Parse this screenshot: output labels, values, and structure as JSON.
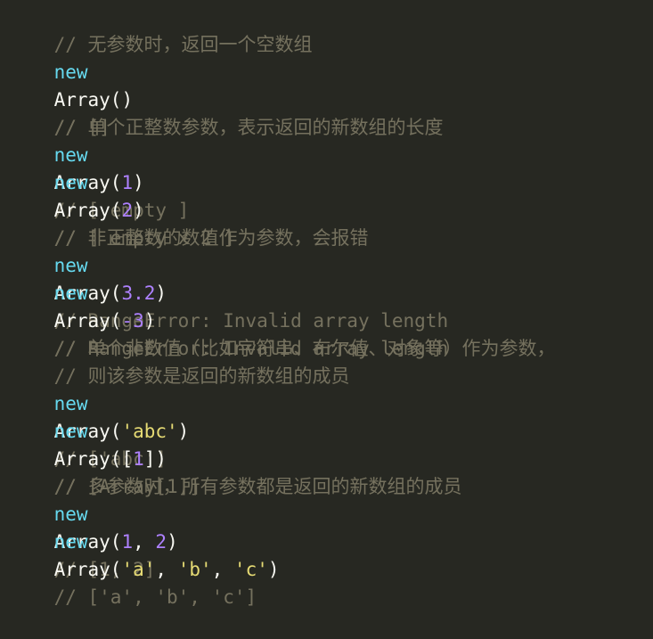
{
  "code": {
    "block1": {
      "comment": "// 无参数时，返回一个空数组",
      "line1": {
        "kw": "new",
        "fn": "Array",
        "open": "(",
        "close": ")",
        "comment": "// []"
      }
    },
    "block2": {
      "comment": "// 单个正整数参数，表示返回的新数组的长度",
      "line1": {
        "kw": "new",
        "fn": "Array",
        "open": "(",
        "arg": "1",
        "close": ")",
        "comment": "// [ empty ]"
      },
      "line2": {
        "kw": "new",
        "fn": "Array",
        "open": "(",
        "arg": "2",
        "close": ")",
        "comment": "// [ empty x 2 ]"
      }
    },
    "block3": {
      "comment": "// 非正整数的数值作为参数，会报错",
      "line1": {
        "kw": "new",
        "fn": "Array",
        "open": "(",
        "arg": "3.2",
        "close": ")",
        "comment": "// RangeError: Invalid array length"
      },
      "line2": {
        "kw": "new",
        "fn": "Array",
        "open": "(",
        "arg": "-3",
        "close": ")",
        "comment": "// RangeError: Invalid array length"
      }
    },
    "block4": {
      "comment1": "// 单个非数值（比如字符串、布尔值、对象等）作为参数，",
      "comment2": "// 则该参数是返回的新数组的成员",
      "line1": {
        "kw": "new",
        "fn": "Array",
        "open": "(",
        "arg": "'abc'",
        "close": ")",
        "comment": "// ['abc']"
      },
      "line2": {
        "kw": "new",
        "fn": "Array",
        "open": "([",
        "arg": "1",
        "close": "])",
        "comment": "// [Array[1]]"
      }
    },
    "block5": {
      "comment": "// 多参数时，所有参数都是返回的新数组的成员",
      "line1": {
        "kw": "new",
        "fn": "Array",
        "open": "(",
        "arg1": "1",
        "sep": ", ",
        "arg2": "2",
        "close": ")",
        "comment": "// [1, 2]"
      },
      "line2": {
        "kw": "new",
        "fn": "Array",
        "open": "(",
        "arg1": "'a'",
        "sep1": ", ",
        "arg2": "'b'",
        "sep2": ", ",
        "arg3": "'c'",
        "close": ")",
        "comment": "// ['a', 'b', 'c']"
      }
    }
  },
  "colors": {
    "background": "#272822",
    "keyword": "#66d9ef",
    "text": "#f8f8f2",
    "number": "#ae81ff",
    "string": "#e6db74",
    "comment": "#75715e"
  }
}
